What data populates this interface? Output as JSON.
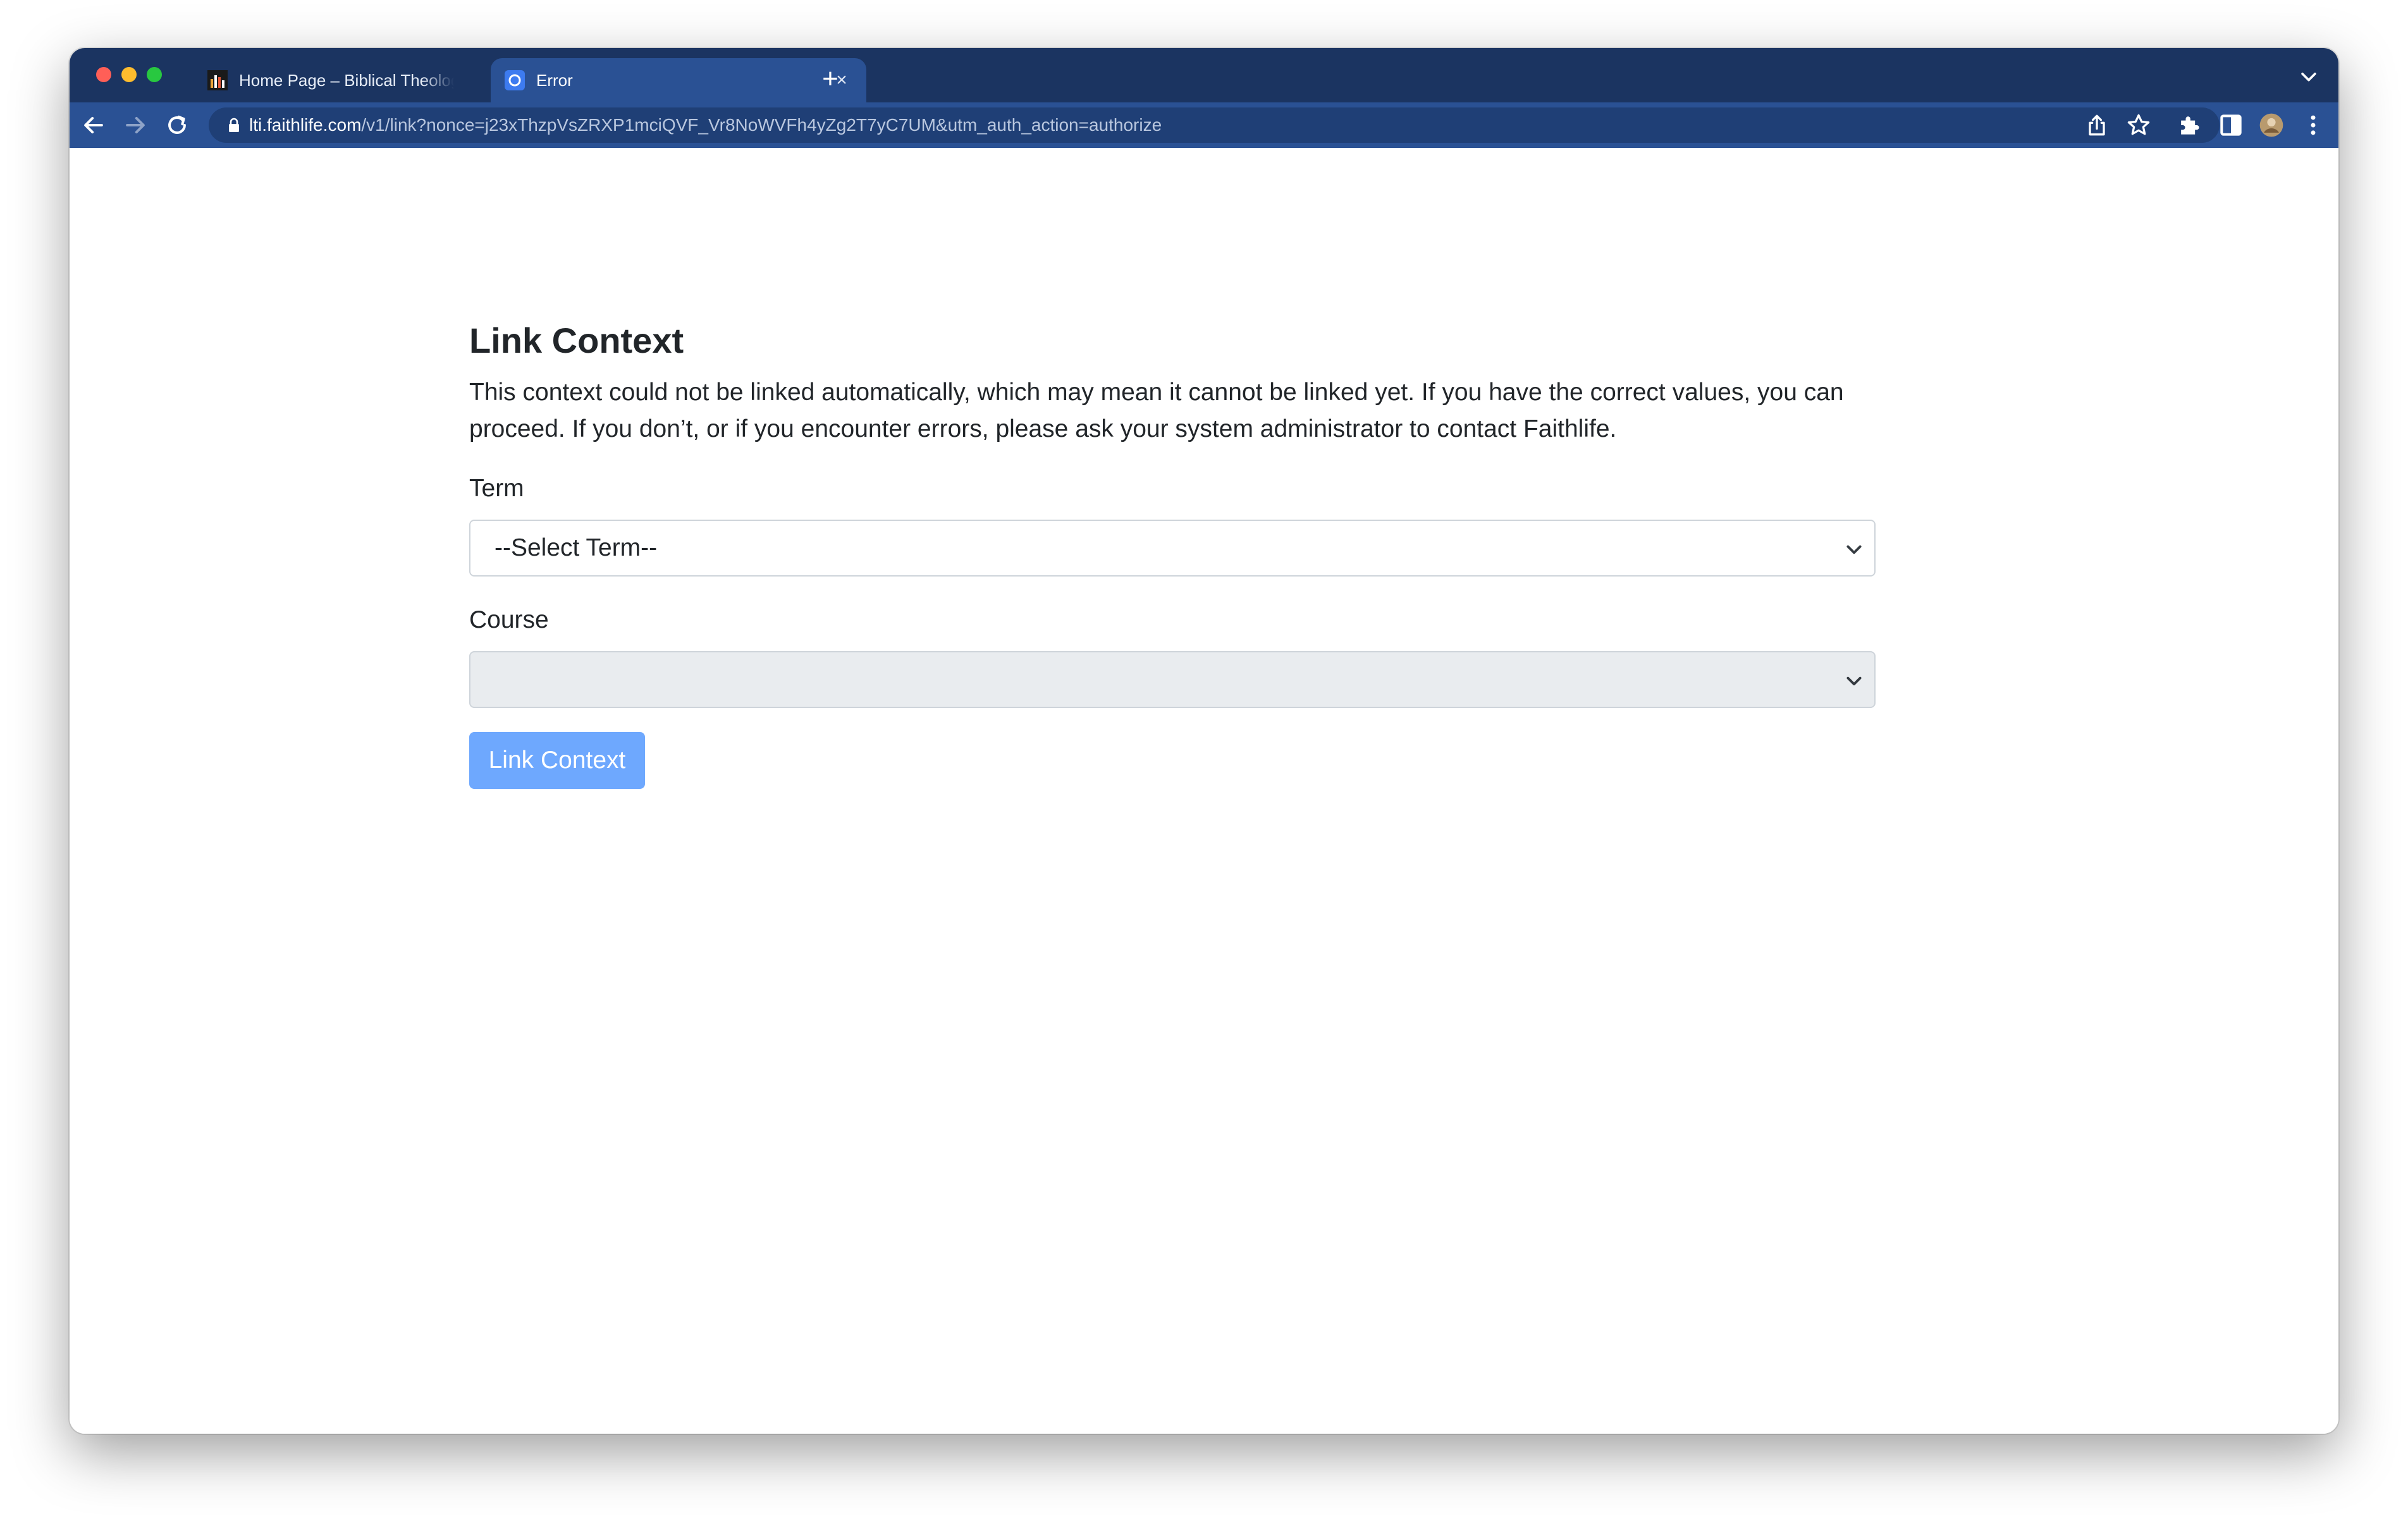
{
  "browser": {
    "tabs": [
      {
        "title": "Home Page – Biblical Theology",
        "active": false,
        "favicon": "bar-chart-favicon"
      },
      {
        "title": "Error",
        "active": true,
        "favicon": "faithlife-favicon"
      }
    ],
    "close_glyph": "×",
    "new_tab_glyph": "+",
    "url_host": "lti.faithlife.com",
    "url_path": "/v1/link?nonce=j23xThzpVsZRXP1mciQVF_Vr8NoWVFh4yZg2T7yC7UM&utm_auth_action=authorize",
    "colors": {
      "tabbar": "#1b3461",
      "toolbar": "#2a5194"
    }
  },
  "page": {
    "title": "Link Context",
    "description": "This context could not be linked automatically, which may mean it cannot be linked yet. If you have the correct values, you can proceed. If you don’t, or if you encounter errors, please ask your system administrator to contact Faithlife.",
    "term": {
      "label": "Term",
      "selected": "--Select Term--"
    },
    "course": {
      "label": "Course",
      "selected": "",
      "disabled": true
    },
    "submit_label": "Link Context",
    "colors": {
      "button": "#6ea8fe",
      "text": "#212529",
      "disabled_field": "#e9ecef"
    }
  }
}
